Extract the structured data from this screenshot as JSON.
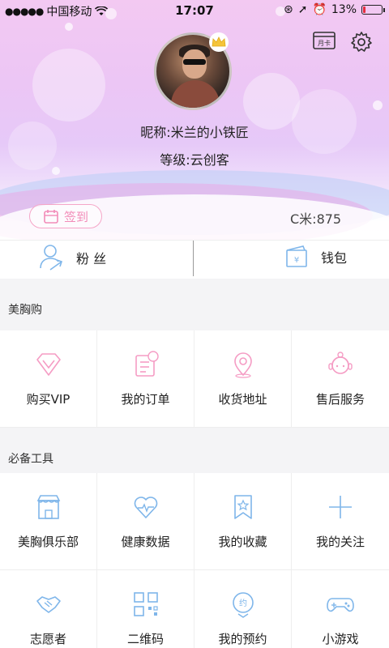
{
  "status_bar": {
    "carrier": "中国移动",
    "time": "17:07",
    "battery": "13%",
    "battery_level": 0.13
  },
  "profile": {
    "nickname": "昵称:米兰的小铁匠",
    "level": "等级:云创客",
    "card_icon_text": "月卡",
    "signin_label": "签到",
    "cmi": "C米:875"
  },
  "stats": {
    "fans_label": "粉 丝",
    "wallet_label": "钱包"
  },
  "sections": [
    {
      "title": "美胸购",
      "items": [
        {
          "label": "购买VIP",
          "icon": "diamond-icon"
        },
        {
          "label": "我的订单",
          "icon": "order-icon"
        },
        {
          "label": "收货地址",
          "icon": "location-pin-icon"
        },
        {
          "label": "售后服务",
          "icon": "service-agent-icon"
        }
      ]
    },
    {
      "title": "必备工具",
      "items": [
        {
          "label": "美胸俱乐部",
          "icon": "shop-icon"
        },
        {
          "label": "健康数据",
          "icon": "heart-pulse-icon"
        },
        {
          "label": "我的收藏",
          "icon": "bookmark-star-icon"
        },
        {
          "label": "我的关注",
          "icon": "plus-icon"
        }
      ]
    },
    {
      "title": "",
      "items": [
        {
          "label": "志愿者",
          "icon": "handshake-icon"
        },
        {
          "label": "二维码",
          "icon": "qr-code-icon"
        },
        {
          "label": "我的预约",
          "icon": "appointment-icon"
        },
        {
          "label": "小游戏",
          "icon": "gamepad-icon"
        }
      ]
    }
  ],
  "colors": {
    "accent_pink": "#f28cb8",
    "accent_blue": "#7fb6ea"
  }
}
